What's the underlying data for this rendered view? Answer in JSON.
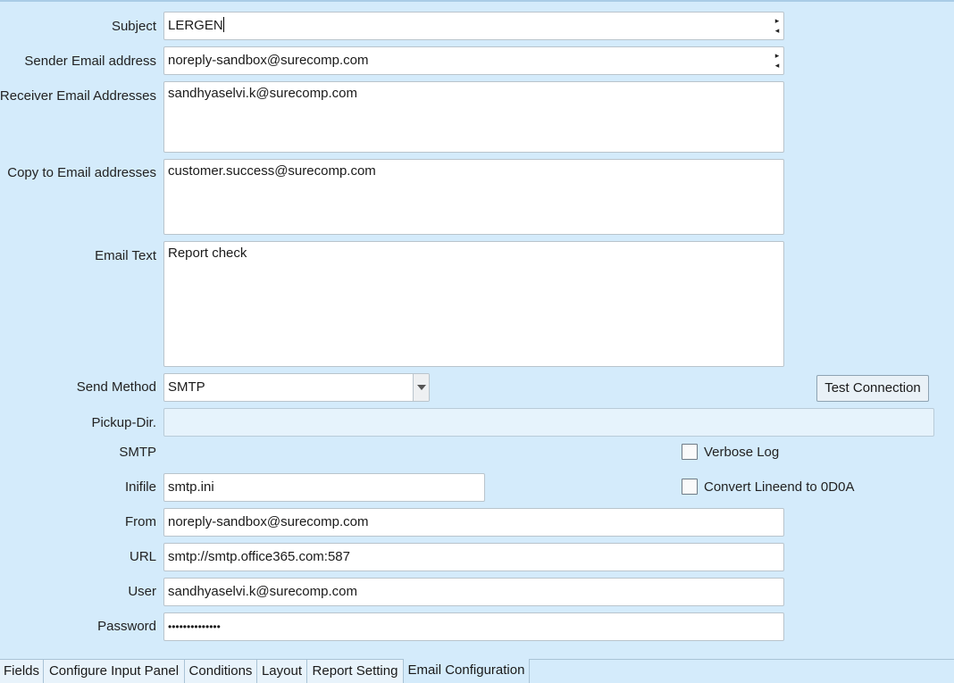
{
  "subject": {
    "label": "Subject",
    "value": "LERGEN"
  },
  "sender": {
    "label": "Sender Email address",
    "value": "noreply-sandbox@surecomp.com"
  },
  "receiver": {
    "label": "Receiver Email Addresses",
    "value": "sandhyaselvi.k@surecomp.com"
  },
  "copy_to": {
    "label": "Copy to Email addresses",
    "value": "customer.success@surecomp.com"
  },
  "email_text": {
    "label": "Email Text",
    "value": "Report check"
  },
  "send_method": {
    "label": "Send Method",
    "value": "SMTP"
  },
  "test_connection_label": "Test Connection",
  "pickup_dir": {
    "label": "Pickup-Dir.",
    "value": ""
  },
  "smtp_section_label": "SMTP",
  "verbose_log": {
    "label": "Verbose Log",
    "checked": false
  },
  "convert_lineend": {
    "label": "Convert Lineend to 0D0A",
    "checked": false
  },
  "inifile": {
    "label": "Inifile",
    "value": "smtp.ini"
  },
  "from": {
    "label": "From",
    "value": "noreply-sandbox@surecomp.com"
  },
  "url": {
    "label": "URL",
    "value": "smtp://smtp.office365.com:587"
  },
  "user": {
    "label": "User",
    "value": "sandhyaselvi.k@surecomp.com"
  },
  "password": {
    "label": "Password",
    "value": "••••••••••••••"
  },
  "tabs": [
    "Fields",
    "Configure Input Panel",
    "Conditions",
    "Layout",
    "Report Setting",
    "Email Configuration"
  ],
  "active_tab": "Email Configuration"
}
